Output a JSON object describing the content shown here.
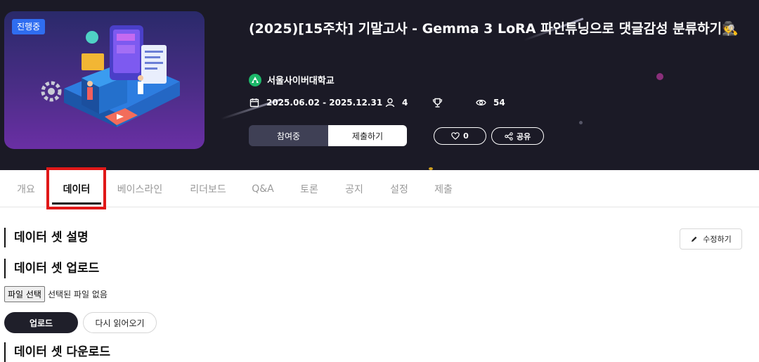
{
  "hero": {
    "status_badge": "진행중",
    "title": "(2025)[15주차] 기말고사 - Gemma 3 LoRA 파인튜닝으로 댓글감성 분류하기🕵️",
    "organization": "서울사이버대학교",
    "period": "2025.06.02 - 2025.12.31",
    "participants": "4",
    "views": "54",
    "participating_label": "참여중",
    "submit_label": "제출하기",
    "like_count": "0",
    "share_label": "공유"
  },
  "tabs": [
    {
      "label": "개요"
    },
    {
      "label": "데이터"
    },
    {
      "label": "베이스라인"
    },
    {
      "label": "리더보드"
    },
    {
      "label": "Q&A"
    },
    {
      "label": "토론"
    },
    {
      "label": "공지"
    },
    {
      "label": "설정"
    },
    {
      "label": "제출"
    }
  ],
  "active_tab": "데이터",
  "content": {
    "dataset_description_title": "데이터 셋 설명",
    "edit_label": "수정하기",
    "dataset_upload_title": "데이터 셋 업로드",
    "file_button_label": "파일 선택",
    "file_status": "선택된 파일 없음",
    "upload_label": "업로드",
    "reload_label": "다시 읽어오기",
    "dataset_download_title": "데이터 셋 다운로드"
  },
  "colors": {
    "hero_bg": "#1b1a26",
    "badge": "#2f6df0",
    "highlight": "#e01818",
    "org_logo": "#1db86a"
  }
}
